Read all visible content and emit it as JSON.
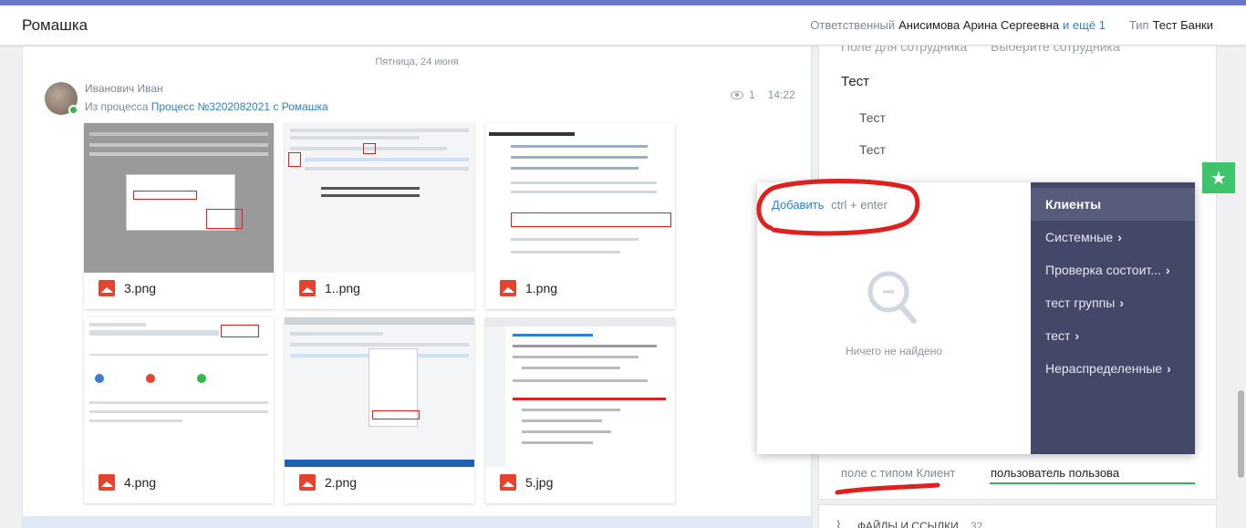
{
  "header": {
    "title": "Ромашка",
    "responsible_label": "Ответственный",
    "responsible_name": "Анисимова Арина Сергеевна",
    "more_link": "и ещё 1",
    "type_label": "Тип",
    "type_value": "Тест Банки"
  },
  "feed": {
    "date": "Пятница, 24 июня",
    "author": "Иванович Иван",
    "from_prefix": "Из процесса",
    "process_link": "Процесс №3202082021 с Ромашка",
    "views": "1",
    "time": "14:22",
    "attachments": [
      {
        "name": "3.png"
      },
      {
        "name": "1..png"
      },
      {
        "name": "1.png"
      },
      {
        "name": "4.png"
      },
      {
        "name": "2.png"
      },
      {
        "name": "5.jpg"
      }
    ]
  },
  "side": {
    "field_label_top": "Поле для сотрудника",
    "field_value_top": "Выберите сотрудника",
    "test_header": "Тест",
    "test_item_1": "Тест",
    "test_item_2": "Тест",
    "client_field_label": "поле с типом Клиент",
    "client_field_value": "пользователь пользова",
    "files_label": "ФАЙЛЫ И ССЫЛКИ",
    "files_count": "32"
  },
  "popup": {
    "add_label": "Добавить",
    "shortcut": "ctrl + enter",
    "empty_text": "Ничего не найдено",
    "menu": [
      {
        "label": "Клиенты",
        "active": true,
        "chevron": ""
      },
      {
        "label": "Системные",
        "active": false,
        "chevron": "›"
      },
      {
        "label": "Проверка состоит...",
        "active": false,
        "chevron": "›"
      },
      {
        "label": "тест группы",
        "active": false,
        "chevron": "›"
      },
      {
        "label": "тест",
        "active": false,
        "chevron": "›"
      },
      {
        "label": "Нераспределенные",
        "active": false,
        "chevron": "›"
      }
    ]
  },
  "colors": {
    "accent": "#6a74c9",
    "link": "#2f7fd6",
    "menu_bg": "#434869",
    "star_button": "#3fc46c",
    "annotation": "#e01f1f"
  },
  "icons": [
    "eye-icon",
    "image-file-icon",
    "magnifier-icon",
    "star-icon",
    "paperclip-icon",
    "chevron-right-icon"
  ]
}
